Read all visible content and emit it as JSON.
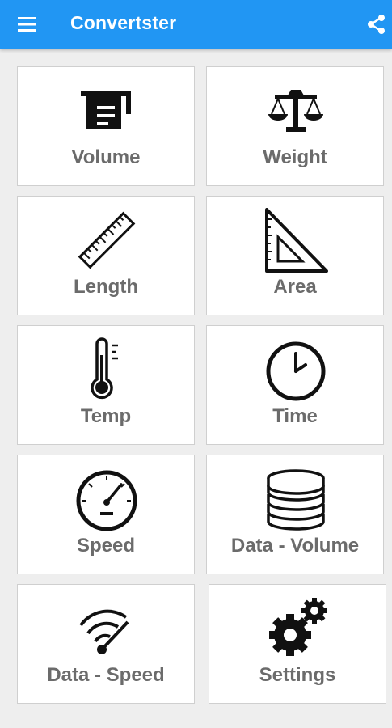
{
  "appbar": {
    "title": "Convertster",
    "background": "#2196f3",
    "menu_icon": "hamburger-menu-icon",
    "share_icon": "share-icon"
  },
  "tiles": [
    {
      "label": "Volume",
      "icon": "measuring-cup-icon"
    },
    {
      "label": "Weight",
      "icon": "balance-scale-icon"
    },
    {
      "label": "Length",
      "icon": "ruler-icon"
    },
    {
      "label": "Area",
      "icon": "set-square-icon"
    },
    {
      "label": "Temp",
      "icon": "thermometer-icon"
    },
    {
      "label": "Time",
      "icon": "clock-icon"
    },
    {
      "label": "Speed",
      "icon": "speedometer-icon"
    },
    {
      "label": "Data - Volume",
      "icon": "database-icon"
    },
    {
      "label": "Data - Speed",
      "icon": "wifi-gauge-icon"
    },
    {
      "label": "Settings",
      "icon": "gears-icon"
    }
  ]
}
